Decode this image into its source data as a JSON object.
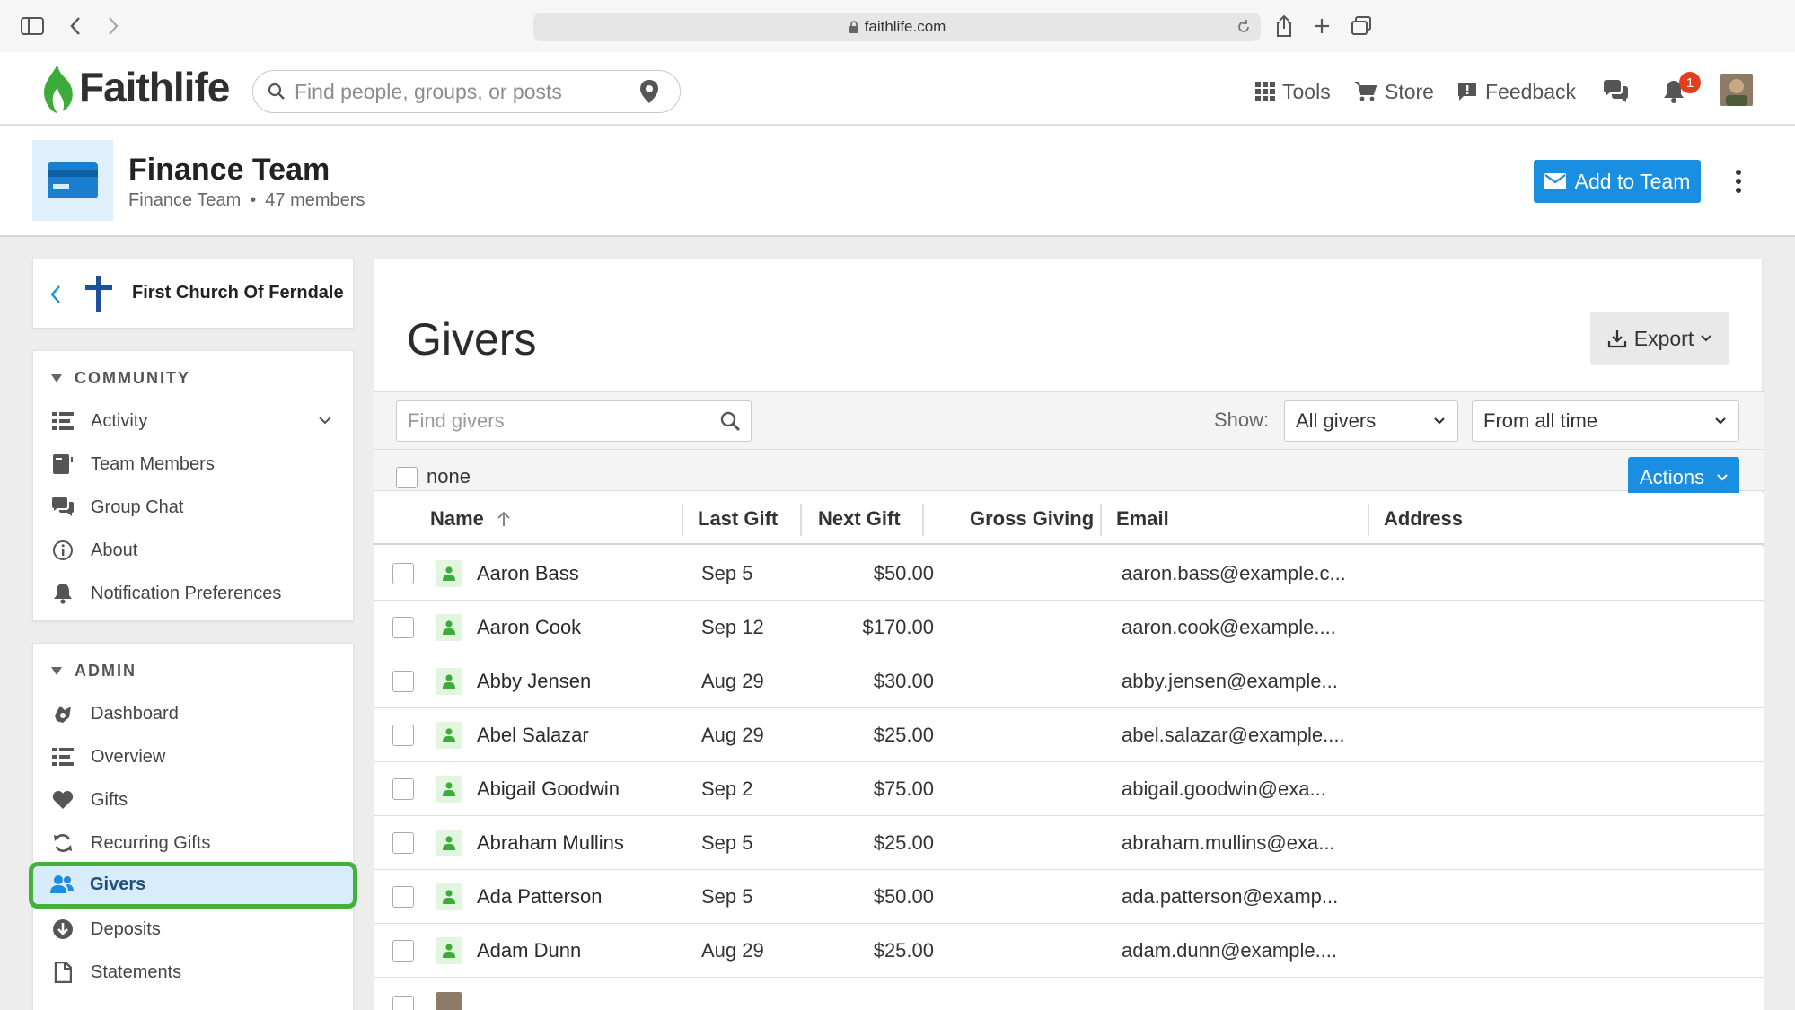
{
  "browser": {
    "url": "faithlife.com"
  },
  "nav": {
    "logo": "Faithlife",
    "search_placeholder": "Find people, groups, or posts",
    "tools": "Tools",
    "store": "Store",
    "feedback": "Feedback",
    "notification_count": "1"
  },
  "group": {
    "title": "Finance Team",
    "subtitle_name": "Finance Team",
    "separator": "•",
    "members": "47 members",
    "add_button": "Add to Team"
  },
  "sidebar": {
    "church": "First Church Of Ferndale",
    "community_heading": "COMMUNITY",
    "community_items": [
      {
        "label": "Activity",
        "icon": "list-icon"
      },
      {
        "label": "Team Members",
        "icon": "members-icon"
      },
      {
        "label": "Group Chat",
        "icon": "chat-icon"
      },
      {
        "label": "About",
        "icon": "info-icon"
      },
      {
        "label": "Notification Preferences",
        "icon": "bell-icon"
      }
    ],
    "admin_heading": "ADMIN",
    "admin_items": [
      {
        "label": "Dashboard",
        "icon": "dashboard-icon"
      },
      {
        "label": "Overview",
        "icon": "list-icon"
      },
      {
        "label": "Gifts",
        "icon": "heart-icon"
      },
      {
        "label": "Recurring Gifts",
        "icon": "recurring-icon"
      },
      {
        "label": "Givers",
        "icon": "people-icon"
      },
      {
        "label": "Deposits",
        "icon": "deposit-icon"
      },
      {
        "label": "Statements",
        "icon": "document-icon"
      }
    ]
  },
  "main": {
    "title": "Givers",
    "export": "Export",
    "find_placeholder": "Find givers",
    "show_label": "Show:",
    "show_value": "All givers",
    "period_value": "From all time",
    "select_label": "none",
    "actions": "Actions",
    "columns": {
      "name": "Name",
      "last_gift": "Last Gift",
      "next_gift": "Next Gift",
      "gross_giving": "Gross Giving",
      "email": "Email",
      "address": "Address"
    },
    "rows": [
      {
        "name": "Aaron Bass",
        "last": "Sep 5",
        "gross": "$50.00",
        "email": "aaron.bass@example.c..."
      },
      {
        "name": "Aaron Cook",
        "last": "Sep 12",
        "gross": "$170.00",
        "email": "aaron.cook@example...."
      },
      {
        "name": "Abby Jensen",
        "last": "Aug 29",
        "gross": "$30.00",
        "email": "abby.jensen@example..."
      },
      {
        "name": "Abel Salazar",
        "last": "Aug 29",
        "gross": "$25.00",
        "email": "abel.salazar@example...."
      },
      {
        "name": "Abigail Goodwin",
        "last": "Sep 2",
        "gross": "$75.00",
        "email": "abigail.goodwin@exa..."
      },
      {
        "name": "Abraham Mullins",
        "last": "Sep 5",
        "gross": "$25.00",
        "email": "abraham.mullins@exa..."
      },
      {
        "name": "Ada Patterson",
        "last": "Sep 5",
        "gross": "$50.00",
        "email": "ada.patterson@examp..."
      },
      {
        "name": "Adam Dunn",
        "last": "Aug 29",
        "gross": "$25.00",
        "email": "adam.dunn@example...."
      }
    ]
  },
  "colors": {
    "accent": "#1a8ee0",
    "brand_green": "#3dab3a",
    "active_outline": "#45b13a"
  }
}
